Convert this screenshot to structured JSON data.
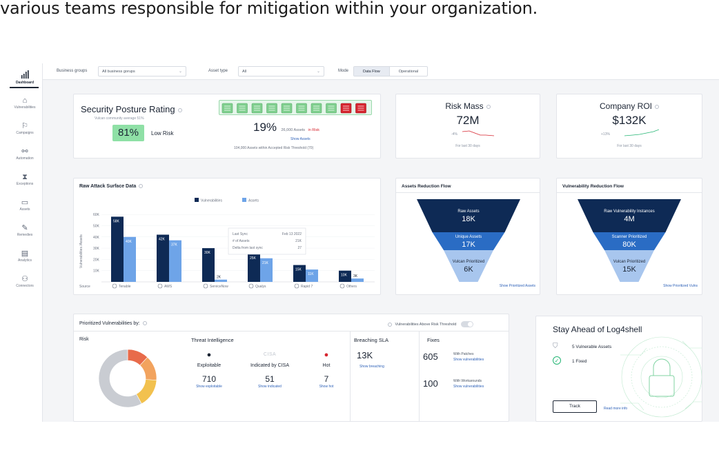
{
  "caption": "various teams responsible for mitigation within your organization.",
  "colors": {
    "navy": "#0e2a55",
    "mid_blue": "#2a6cc4",
    "light_blue": "#6ea4e8",
    "pale_blue": "#a8c6ee",
    "green": "#22b573",
    "red": "#d6252f",
    "orange": "#e86b4a",
    "yellow": "#f2c14e",
    "gray": "#cfd2d8"
  },
  "sidebar": {
    "items": [
      {
        "label": "Dashboard",
        "icon": "chart-icon"
      },
      {
        "label": "Vulnerabilities",
        "icon": "bug-icon"
      },
      {
        "label": "Campaigns",
        "icon": "flag-icon"
      },
      {
        "label": "Automation",
        "icon": "automation-icon"
      },
      {
        "label": "Exceptions",
        "icon": "hourglass-icon"
      },
      {
        "label": "Assets",
        "icon": "monitor-icon"
      },
      {
        "label": "Remedies",
        "icon": "wrench-icon"
      },
      {
        "label": "Analytics",
        "icon": "document-icon"
      },
      {
        "label": "Connectors",
        "icon": "plug-icon"
      }
    ]
  },
  "filters": {
    "business_groups_label": "Business groups",
    "business_groups_value": "All business gorups",
    "asset_type_label": "Asset type",
    "asset_type_value": "All",
    "mode_label": "Mode",
    "mode_options": [
      "Data Flow",
      "Operational"
    ]
  },
  "posture": {
    "title": "Security Posture Rating",
    "subtitle": "Vulcan community average 51%",
    "score": "81%",
    "risk_label": "Low Risk",
    "assets_pct": "19%",
    "assets_count": "26,000 Assets",
    "assets_status": "in Risk",
    "show_assets": "Show Assets",
    "threshold_text": "104,000 Assets within Accepted Risk Threshold (70)"
  },
  "risk_mass": {
    "title": "Risk Mass",
    "value": "72M",
    "change": "-4%",
    "period": "For last 30 days"
  },
  "company_roi": {
    "title": "Company ROI",
    "value": "$132K",
    "change": "+13%",
    "period": "For last 30 days"
  },
  "raw_attack": {
    "title": "Raw Attack Surface Data",
    "legend": [
      "Vulnerabilities",
      "Assets"
    ],
    "source_label": "Source",
    "tooltip": {
      "rows": [
        [
          "Last Sync",
          "Feb 13 2022"
        ],
        [
          "# of Assets",
          "21K"
        ],
        [
          "Delta from last sync",
          "27"
        ]
      ]
    }
  },
  "chart_data": {
    "type": "bar",
    "title": "Raw Attack Surface Data",
    "ylabel": "Vulnerabilities /Assets",
    "xlabel": "Source",
    "categories": [
      "Tenable",
      "AWS",
      "ServiceNow",
      "Qualys",
      "Rapid 7",
      "Others"
    ],
    "series": [
      {
        "name": "Vulnerabilities",
        "values": [
          58,
          42,
          30,
          25,
          15,
          10
        ]
      },
      {
        "name": "Assets",
        "values": [
          40,
          37,
          2,
          21,
          11,
          3
        ]
      }
    ],
    "value_labels": [
      [
        "58K",
        "40K"
      ],
      [
        "42K",
        "37K"
      ],
      [
        "30K",
        "2K"
      ],
      [
        "25K",
        "21K"
      ],
      [
        "15K",
        "11K"
      ],
      [
        "10K",
        "3K"
      ]
    ],
    "yticks": [
      "10K",
      "20K",
      "30K",
      "40K",
      "50K",
      "60K"
    ],
    "ylim": [
      0,
      65
    ],
    "legend": "top-center"
  },
  "assets_flow": {
    "title": "Assets Reduction Flow",
    "stages": [
      {
        "label": "Raw Assets",
        "value": "18K"
      },
      {
        "label": "Unique Assets",
        "value": "17K"
      },
      {
        "label": "Vulcan Prioritized",
        "value": "6K"
      }
    ],
    "link": "Show Prioritized Assets"
  },
  "vuln_flow": {
    "title": "Vulnerability Reduction Flow",
    "stages": [
      {
        "label": "Raw Vulnerability Instances",
        "value": "4M"
      },
      {
        "label": "Scanner Prioritized",
        "value": "80K"
      },
      {
        "label": "Vulcan Prioritized",
        "value": "15K"
      }
    ],
    "link": "Show Prioritized Vulns"
  },
  "prioritized": {
    "title": "Prioritized Vulnerabilities by:",
    "toggle_label": "Vulnerabilities Above Risk Threshold",
    "risk_title": "Risk",
    "threat_title": "Threat Intelligence",
    "threat_items": [
      {
        "label": "Exploitable",
        "value": "710",
        "link": "Show exploitable",
        "icon": "bomb-icon"
      },
      {
        "label": "Indicated by CISA",
        "value": "51",
        "link": "Show indicated",
        "icon": "cisa-logo",
        "logo_text": "CISA"
      },
      {
        "label": "Hot",
        "value": "7",
        "link": "Show hot",
        "icon": "flame-icon"
      }
    ],
    "sla_title": "Breaching SLA",
    "sla_value": "13K",
    "sla_link": "Show breaching",
    "fixes_title": "Fixes",
    "fixes": [
      {
        "value": "605",
        "label": "With Patches",
        "link": "Show vulnerabilities"
      },
      {
        "value": "100",
        "label": "With Workarounds",
        "link": "Show vulnerabilities"
      }
    ],
    "donut": [
      {
        "value": 12,
        "color": "#e86b4a"
      },
      {
        "value": 14,
        "color": "#f2a35e"
      },
      {
        "value": 16,
        "color": "#f2c14e"
      },
      {
        "value": 58,
        "color": "#c9ccd2"
      }
    ]
  },
  "log4shell": {
    "title": "Stay Ahead of Log4shell",
    "items": [
      "5 Vulnerable Assets",
      "1 Fixed"
    ],
    "track_label": "Track",
    "read_more": "Read more info"
  }
}
